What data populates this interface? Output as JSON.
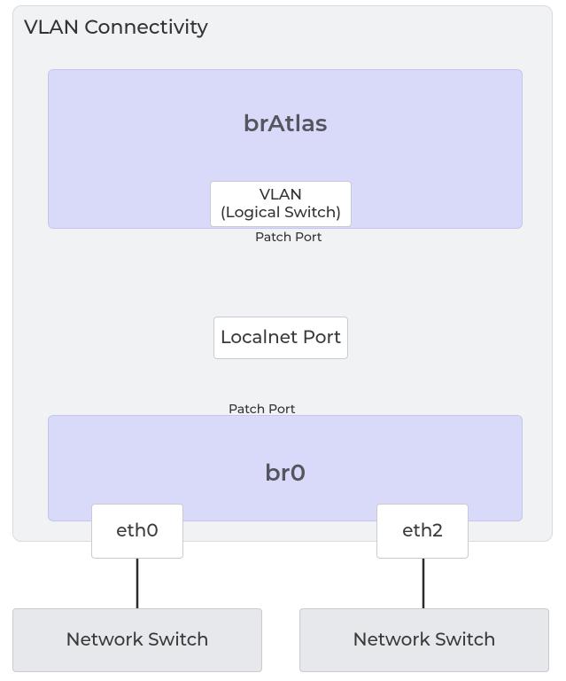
{
  "title": "VLAN Connectivity",
  "bridges": {
    "top": {
      "name": "brAtlas"
    },
    "bottom": {
      "name": "br0"
    }
  },
  "vlan_box": {
    "line1": "VLAN",
    "line2": "(Logical Switch)"
  },
  "localnet_port": "Localnet Port",
  "patch_port_top": "Patch Port",
  "patch_port_bottom": "Patch Port",
  "interfaces": {
    "left": "eth0",
    "right": "eth2"
  },
  "switches": {
    "left": "Network Switch",
    "right": "Network Switch"
  }
}
